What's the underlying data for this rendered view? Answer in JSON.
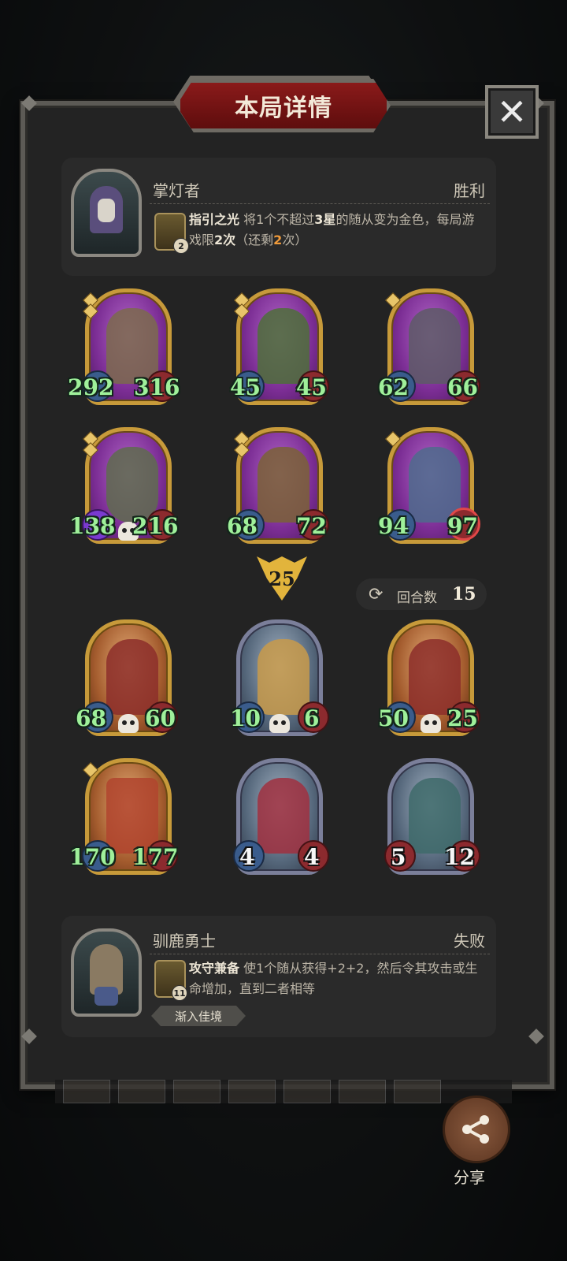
{
  "title": "本局详情",
  "close_label": "✕",
  "top_hero": {
    "name": "掌灯者",
    "result": "胜利",
    "skill_level": "2",
    "skill_name": "指引之光",
    "skill_desc_1": "将1个不超过",
    "skill_desc_2": "3星",
    "skill_desc_3": "的随从变为金色，每局游戏限",
    "skill_desc_4": "2次",
    "skill_desc_5": "（还剩",
    "skill_desc_6": "2",
    "skill_desc_7": "次）"
  },
  "damage": "25",
  "rounds": {
    "label": "回合数",
    "value": "15"
  },
  "bottom_hero": {
    "name": "驯鹿勇士",
    "result": "失败",
    "skill_level": "11",
    "skill_name": "攻守兼备",
    "skill_desc": "使1个随从获得+2+2，然后令其攻击或生命增加，直到二者相等",
    "tag": "渐入佳境"
  },
  "share_label": "分享",
  "top_cards": [
    {
      "atk": "292",
      "hp": "316"
    },
    {
      "atk": "45",
      "hp": "45"
    },
    {
      "atk": "62",
      "hp": "66"
    },
    {
      "atk": "138",
      "hp": "216"
    },
    {
      "atk": "68",
      "hp": "72"
    },
    {
      "atk": "94",
      "hp": "97"
    }
  ],
  "bottom_cards": [
    {
      "atk": "68",
      "hp": "60"
    },
    {
      "atk": "10",
      "hp": "6"
    },
    {
      "atk": "50",
      "hp": "25"
    },
    {
      "atk": "170",
      "hp": "177"
    },
    {
      "atk": "4",
      "hp": "4"
    },
    {
      "atk": "5",
      "hp": "12"
    }
  ]
}
